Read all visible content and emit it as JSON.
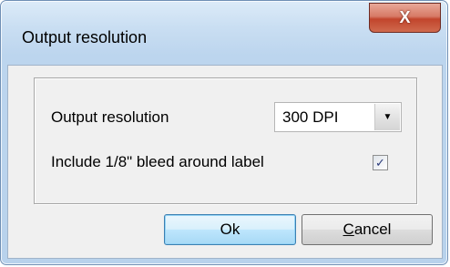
{
  "window": {
    "title": "Output resolution",
    "close_glyph": "X"
  },
  "form": {
    "resolution_label": "Output resolution",
    "resolution_value": "300 DPI",
    "bleed_label": "Include 1/8\" bleed around label",
    "bleed_checked": true
  },
  "buttons": {
    "ok_label": "Ok",
    "cancel_first": "C",
    "cancel_rest": "ancel"
  },
  "icons": {
    "dropdown": "chevron-down-icon",
    "check": "check-icon",
    "close": "close-icon"
  },
  "colors": {
    "title_bar": "#c9def2",
    "close_button": "#c2452c",
    "default_button": "#bee6fd"
  }
}
